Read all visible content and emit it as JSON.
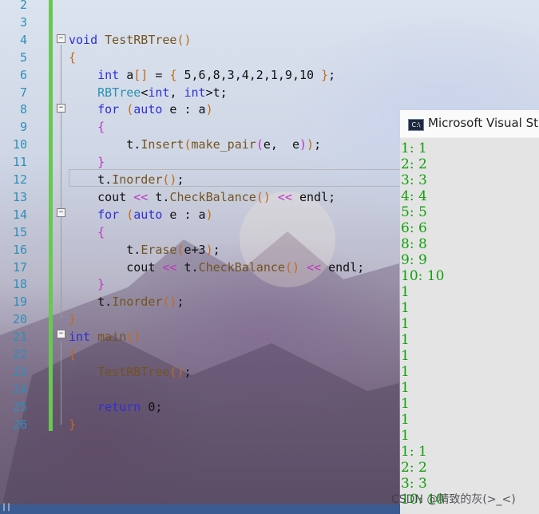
{
  "editor": {
    "line_numbers": [
      "2",
      "3",
      "4",
      "5",
      "6",
      "7",
      "8",
      "9",
      "10",
      "11",
      "12",
      "13",
      "14",
      "15",
      "16",
      "17",
      "18",
      "19",
      "20",
      "21",
      "22",
      "23",
      "24",
      "25",
      "26"
    ],
    "code_lines": [
      {
        "segments": [
          {
            "t": "",
            "c": ""
          }
        ]
      },
      {
        "segments": [
          {
            "t": "",
            "c": ""
          }
        ]
      },
      {
        "segments": [
          {
            "t": "void",
            "c": "kw"
          },
          {
            "t": " TestRBTree",
            "c": "fn"
          },
          {
            "t": "()",
            "c": "br"
          }
        ]
      },
      {
        "segments": [
          {
            "t": "{",
            "c": "br"
          }
        ]
      },
      {
        "segments": [
          {
            "t": "    ",
            "c": ""
          },
          {
            "t": "int",
            "c": "kw"
          },
          {
            "t": " a",
            "c": ""
          },
          {
            "t": "[]",
            "c": "br"
          },
          {
            "t": " = ",
            "c": ""
          },
          {
            "t": "{",
            "c": "br"
          },
          {
            "t": " 5,6,8,3,4,2,1,9,10 ",
            "c": ""
          },
          {
            "t": "}",
            "c": "br"
          },
          {
            "t": ";",
            "c": ""
          }
        ]
      },
      {
        "segments": [
          {
            "t": "    ",
            "c": ""
          },
          {
            "t": "RBTree",
            "c": "ty"
          },
          {
            "t": "<",
            "c": ""
          },
          {
            "t": "int",
            "c": "kw"
          },
          {
            "t": ", ",
            "c": ""
          },
          {
            "t": "int",
            "c": "kw"
          },
          {
            "t": ">t;",
            "c": ""
          }
        ]
      },
      {
        "segments": [
          {
            "t": "    ",
            "c": ""
          },
          {
            "t": "for",
            "c": "kw"
          },
          {
            "t": " ",
            "c": ""
          },
          {
            "t": "(",
            "c": "br"
          },
          {
            "t": "auto",
            "c": "kw"
          },
          {
            "t": " e : a",
            "c": ""
          },
          {
            "t": ")",
            "c": "br"
          }
        ]
      },
      {
        "segments": [
          {
            "t": "    ",
            "c": ""
          },
          {
            "t": "{",
            "c": "br2"
          }
        ]
      },
      {
        "segments": [
          {
            "t": "        t.",
            "c": ""
          },
          {
            "t": "Insert",
            "c": "fn"
          },
          {
            "t": "(",
            "c": "br"
          },
          {
            "t": "make_pair",
            "c": "fn"
          },
          {
            "t": "(",
            "c": "br2"
          },
          {
            "t": "e,  e",
            "c": ""
          },
          {
            "t": ")",
            "c": "br2"
          },
          {
            "t": ")",
            "c": "br"
          },
          {
            "t": ";",
            "c": ""
          }
        ]
      },
      {
        "segments": [
          {
            "t": "    ",
            "c": ""
          },
          {
            "t": "}",
            "c": "br2"
          }
        ]
      },
      {
        "segments": [
          {
            "t": "    t.",
            "c": ""
          },
          {
            "t": "Inorder",
            "c": "fn"
          },
          {
            "t": "()",
            "c": "br"
          },
          {
            "t": ";",
            "c": ""
          }
        ]
      },
      {
        "segments": [
          {
            "t": "    cout ",
            "c": ""
          },
          {
            "t": "<<",
            "c": "br2"
          },
          {
            "t": " t.",
            "c": ""
          },
          {
            "t": "CheckBalance",
            "c": "fn"
          },
          {
            "t": "()",
            "c": "br"
          },
          {
            "t": " ",
            "c": ""
          },
          {
            "t": "<<",
            "c": "br2"
          },
          {
            "t": " endl;",
            "c": ""
          }
        ]
      },
      {
        "segments": [
          {
            "t": "    ",
            "c": ""
          },
          {
            "t": "for",
            "c": "kw"
          },
          {
            "t": " ",
            "c": ""
          },
          {
            "t": "(",
            "c": "br"
          },
          {
            "t": "auto",
            "c": "kw"
          },
          {
            "t": " e : a",
            "c": ""
          },
          {
            "t": ")",
            "c": "br"
          }
        ]
      },
      {
        "segments": [
          {
            "t": "    ",
            "c": ""
          },
          {
            "t": "{",
            "c": "br2"
          }
        ]
      },
      {
        "segments": [
          {
            "t": "        t.",
            "c": ""
          },
          {
            "t": "Erase",
            "c": "fn"
          },
          {
            "t": "(",
            "c": "br"
          },
          {
            "t": "e+3",
            "c": ""
          },
          {
            "t": ")",
            "c": "br"
          },
          {
            "t": ";",
            "c": ""
          }
        ]
      },
      {
        "segments": [
          {
            "t": "        cout ",
            "c": ""
          },
          {
            "t": "<<",
            "c": "br2"
          },
          {
            "t": " t.",
            "c": ""
          },
          {
            "t": "CheckBalance",
            "c": "fn"
          },
          {
            "t": "()",
            "c": "br"
          },
          {
            "t": " ",
            "c": ""
          },
          {
            "t": "<<",
            "c": "br2"
          },
          {
            "t": " endl;",
            "c": ""
          }
        ]
      },
      {
        "segments": [
          {
            "t": "    ",
            "c": ""
          },
          {
            "t": "}",
            "c": "br2"
          }
        ]
      },
      {
        "segments": [
          {
            "t": "    t.",
            "c": ""
          },
          {
            "t": "Inorder",
            "c": "fn"
          },
          {
            "t": "()",
            "c": "br"
          },
          {
            "t": ";",
            "c": ""
          }
        ]
      },
      {
        "segments": [
          {
            "t": "}",
            "c": "br"
          }
        ]
      },
      {
        "segments": [
          {
            "t": "int",
            "c": "kw"
          },
          {
            "t": " main",
            "c": "fn"
          },
          {
            "t": "()",
            "c": "br"
          }
        ]
      },
      {
        "segments": [
          {
            "t": "{",
            "c": "br"
          }
        ]
      },
      {
        "segments": [
          {
            "t": "    ",
            "c": ""
          },
          {
            "t": "TestRBTree",
            "c": "fn"
          },
          {
            "t": "()",
            "c": "br"
          },
          {
            "t": ";",
            "c": ""
          }
        ]
      },
      {
        "segments": [
          {
            "t": "",
            "c": ""
          }
        ]
      },
      {
        "segments": [
          {
            "t": "    ",
            "c": ""
          },
          {
            "t": "return",
            "c": "kw"
          },
          {
            "t": " 0;",
            "c": ""
          }
        ]
      },
      {
        "segments": [
          {
            "t": "}",
            "c": "br"
          }
        ]
      }
    ],
    "fold_markers": [
      "−",
      "−",
      "−",
      "−"
    ]
  },
  "console": {
    "title": "Microsoft Visual Stu",
    "icon_label": "C:\\",
    "lines": [
      "1: 1",
      "2: 2",
      "3: 3",
      "4: 4",
      "5: 5",
      "6: 6",
      "8: 8",
      "9: 9",
      "10: 10",
      "1",
      "1",
      "1",
      "1",
      "1",
      "1",
      "1",
      "1",
      "1",
      "1",
      "1: 1",
      "2: 2",
      "3: 3",
      "10: 10"
    ]
  },
  "status_bar": {
    "text": "||"
  },
  "watermark": "CSDN @精致的灰(>_<)",
  "colors": {
    "keyword": "#2f2fd6",
    "type": "#2b91af",
    "function": "#74531f",
    "console_text": "#13a10e",
    "change_bar": "#69c850"
  }
}
